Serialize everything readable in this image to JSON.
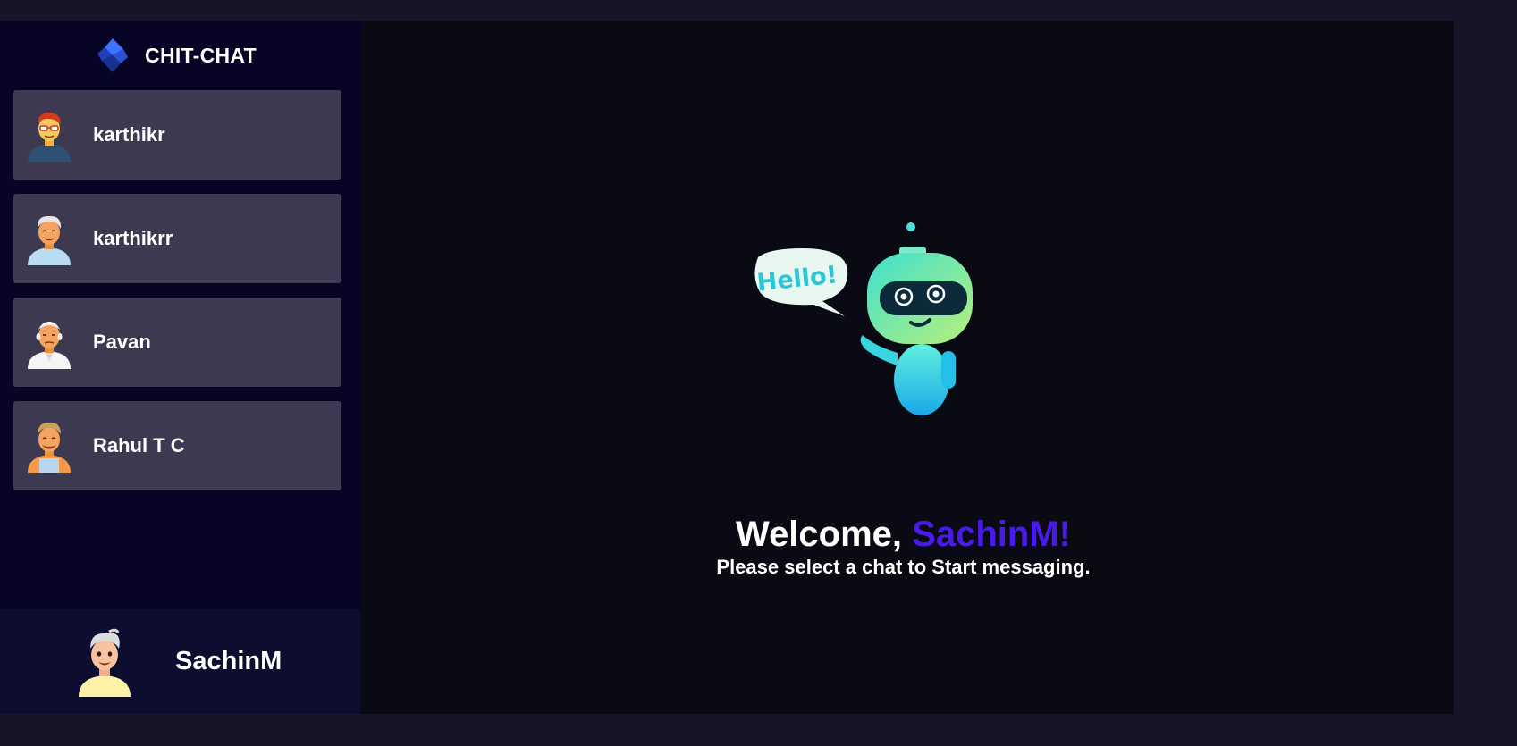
{
  "app": {
    "title": "CHIT-CHAT"
  },
  "contacts": [
    {
      "name": "karthikr",
      "avatar": "avatar-red-hair-glasses-icon"
    },
    {
      "name": "karthikrr",
      "avatar": "avatar-grey-hair-icon"
    },
    {
      "name": "Pavan",
      "avatar": "avatar-bald-man-icon"
    },
    {
      "name": "Rahul T C",
      "avatar": "avatar-blond-man-icon"
    }
  ],
  "current_user": {
    "name": "SachinM",
    "avatar": "avatar-current-user-icon"
  },
  "welcome": {
    "greeting": "Welcome,",
    "username": "SachinM!",
    "subtitle": "Please select a chat to Start messaging.",
    "illustration": "robot-hello-icon",
    "bubble_text": "Hello!"
  },
  "colors": {
    "background": "#161528",
    "sidebar": "#080425",
    "contact_card": "#3c3950",
    "current_user_bar": "#0d0d30",
    "main": "#0a0a14",
    "accent": "#4a1be8"
  }
}
